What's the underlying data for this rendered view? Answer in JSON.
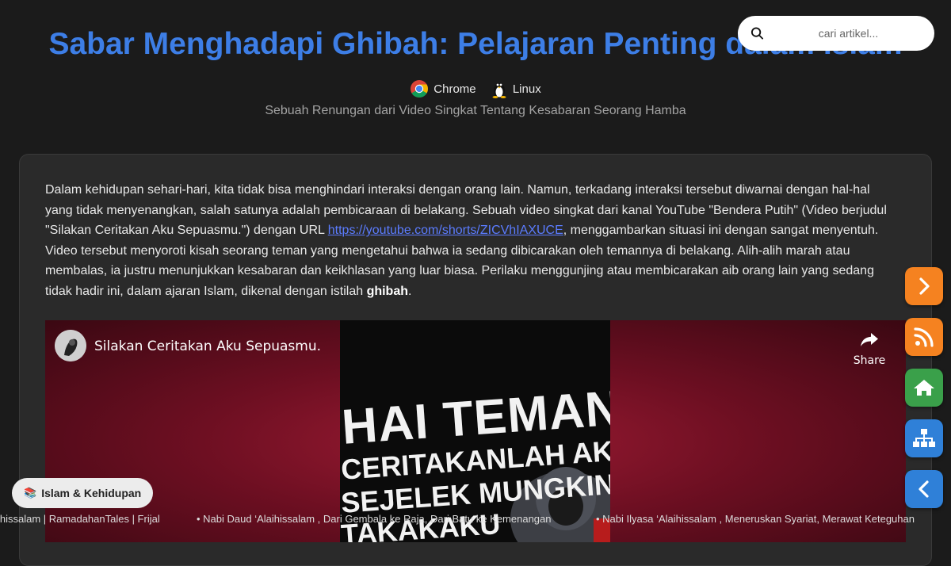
{
  "article": {
    "title": "Sabar Menghadapi Ghibah: Pelajaran Penting dalam Islam",
    "subtitle": "Sebuah Renungan dari Video Singkat Tentang Kesabaran Seorang Hamba"
  },
  "environment": [
    {
      "label": "Chrome",
      "icon": "chrome-icon"
    },
    {
      "label": "Linux",
      "icon": "linux-tux-icon"
    }
  ],
  "search": {
    "placeholder": "cari artikel...",
    "icon": "search-icon"
  },
  "intro": {
    "p1": "Dalam kehidupan sehari-hari, kita tidak bisa menghindari interaksi dengan orang lain. Namun, terkadang interaksi tersebut diwarnai dengan hal-hal yang tidak menyenangkan, salah satunya adalah pembicaraan di belakang. Sebuah video singkat dari kanal YouTube \"Bendera Putih\" (Video berjudul \"Silakan Ceritakan Aku Sepuasmu.\") dengan URL ",
    "link": "https://youtube.com/shorts/ZICVhIAXUCE",
    "p2": ", menggambarkan situasi ini dengan sangat menyentuh. Video tersebut menyoroti kisah seorang teman yang mengetahui bahwa ia sedang dibicarakan oleh temannya di belakang. Alih-alih marah atau membalas, ia justru menunjukkan kesabaran dan keikhlasan yang luar biasa. Perilaku menggunjing atau membicarakan aib orang lain yang sedang tidak hadir ini, dalam ajaran Islam, dikenal dengan istilah ",
    "bold": "ghibah",
    "p3": "."
  },
  "video": {
    "title": "Silakan Ceritakan Aku Sepuasmu.",
    "share_label": "Share",
    "thumb_lines": [
      "HAI TEMAN",
      "CERITAKANLAH AKU",
      "SEJELEK MUNGKIN",
      "TAKAKAKU"
    ]
  },
  "side_buttons": [
    {
      "name": "next-button",
      "icon": "chevron-right-icon",
      "color": "#f58220"
    },
    {
      "name": "rss-button",
      "icon": "rss-icon",
      "color": "#f58220"
    },
    {
      "name": "home-button",
      "icon": "home-icon",
      "color": "#3aa04a"
    },
    {
      "name": "sitemap-button",
      "icon": "sitemap-icon",
      "color": "#2f80d8"
    },
    {
      "name": "prev-button",
      "icon": "chevron-left-icon",
      "color": "#2f80d8"
    }
  ],
  "category_badge": {
    "icon": "📚",
    "label": "Islam & Kehidupan"
  },
  "ticker": [
    "ihissalam | RamadahanTales | Frijal",
    "• Nabi Daud ‘Alaihissalam , Dari Gembala ke Raja, Dari Batu ke Kemenangan",
    "• Nabi Ilyasa ‘Alaihissalam , Meneruskan Syariat, Merawat Keteguhan"
  ]
}
